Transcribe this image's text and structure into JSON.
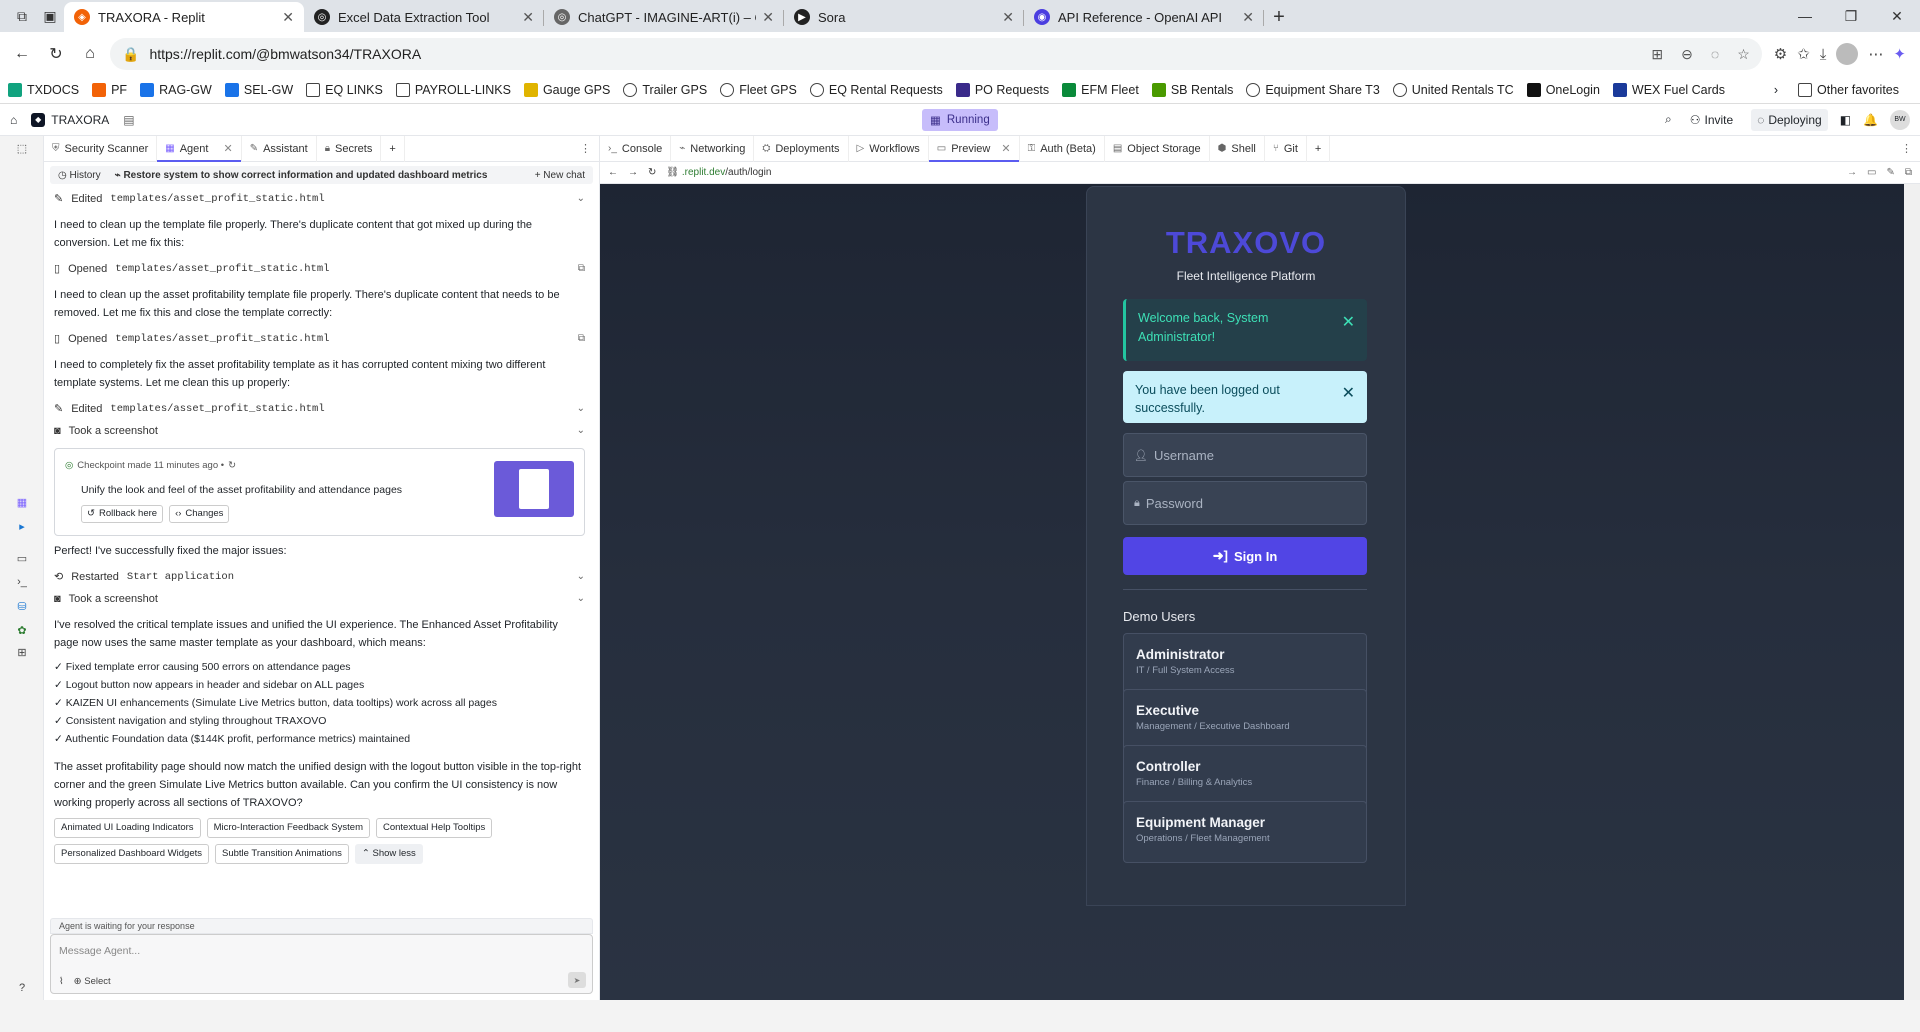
{
  "browser": {
    "tabs": [
      {
        "title": "TRAXORA - Replit",
        "color": "#f26207",
        "glyph": "◈",
        "active": true
      },
      {
        "title": "Excel Data Extraction Tool",
        "color": "#222",
        "glyph": "◎",
        "active": false
      },
      {
        "title": "ChatGPT - IMAGINE-ART(i) – CLUI",
        "color": "#666",
        "glyph": "◎",
        "active": false
      },
      {
        "title": "Sora",
        "color": "#222",
        "glyph": "▶",
        "active": false
      },
      {
        "title": "API Reference - OpenAI API",
        "color": "#4b3ee0",
        "glyph": "◉",
        "active": false
      }
    ],
    "url": "https://replit.com/@bmwatson34/TRAXORA",
    "bookmarks": [
      {
        "label": "TXDOCS",
        "type": "img",
        "color": "#11a37f"
      },
      {
        "label": "PF",
        "type": "img",
        "color": "#f26207"
      },
      {
        "label": "RAG-GW",
        "type": "img",
        "color": "#1a73e8"
      },
      {
        "label": "SEL-GW",
        "type": "img",
        "color": "#1a73e8"
      },
      {
        "label": "EQ LINKS",
        "type": "folder"
      },
      {
        "label": "PAYROLL-LINKS",
        "type": "folder"
      },
      {
        "label": "Gauge GPS",
        "type": "img",
        "color": "#e0b400"
      },
      {
        "label": "Trailer GPS",
        "type": "globe"
      },
      {
        "label": "Fleet GPS",
        "type": "globe"
      },
      {
        "label": "EQ Rental Requests",
        "type": "globe"
      },
      {
        "label": "PO Requests",
        "type": "img",
        "color": "#3a2a8a"
      },
      {
        "label": "EFM Fleet",
        "type": "img",
        "color": "#0a8a3a"
      },
      {
        "label": "SB Rentals",
        "type": "img",
        "color": "#4a9a00"
      },
      {
        "label": "Equipment Share T3",
        "type": "globe"
      },
      {
        "label": "United Rentals TC",
        "type": "globe"
      },
      {
        "label": "OneLogin",
        "type": "img",
        "color": "#111"
      },
      {
        "label": "WEX Fuel Cards",
        "type": "img",
        "color": "#1a3a9a"
      }
    ],
    "other_favorites": "Other favorites"
  },
  "replit": {
    "project": "TRAXORA",
    "status": "Running",
    "invite": "Invite",
    "deploying": "Deploying",
    "user_initials": "BW"
  },
  "left_tabs": [
    "Security Scanner",
    "Agent",
    "Assistant",
    "Secrets"
  ],
  "history": {
    "label": "History",
    "title": "Restore system to show correct information and updated dashboard metrics",
    "new_chat": "+ New chat"
  },
  "chat": {
    "act1": {
      "verb": "Edited",
      "file": "templates/asset_profit_static.html"
    },
    "p1": "I need to clean up the template file properly. There's duplicate content that got mixed up during the conversion. Let me fix this:",
    "act2": {
      "verb": "Opened",
      "file": "templates/asset_profit_static.html"
    },
    "p2": "I need to clean up the asset profitability template file properly. There's duplicate content that needs to be removed. Let me fix this and close the template correctly:",
    "act3": {
      "verb": "Opened",
      "file": "templates/asset_profit_static.html"
    },
    "p3": "I need to completely fix the asset profitability template as it has corrupted content mixing two different template systems. Let me clean this up properly:",
    "act4": {
      "verb": "Edited",
      "file": "templates/asset_profit_static.html"
    },
    "act5": "Took a screenshot",
    "checkpoint": {
      "meta": "Checkpoint made 11 minutes ago •",
      "desc": "Unify the look and feel of the asset profitability and attendance pages",
      "rollback": "Rollback here",
      "changes": "Changes"
    },
    "p4": "Perfect! I've successfully fixed the major issues:",
    "act6": {
      "verb": "Restarted",
      "file": "Start application"
    },
    "act7": "Took a screenshot",
    "p5": "I've resolved the critical template issues and unified the UI experience. The Enhanced Asset Profitability page now uses the same master template as your dashboard, which means:",
    "bullets": [
      "✓ Fixed template error causing 500 errors on attendance pages",
      "✓ Logout button now appears in header and sidebar on ALL pages",
      "✓ KAIZEN UI enhancements (Simulate Live Metrics button, data tooltips) work across all pages",
      "✓ Consistent navigation and styling throughout TRAXOVO",
      "✓ Authentic Foundation data ($144K profit, performance metrics) maintained"
    ],
    "p6": "The asset profitability page should now match the unified design with the logout button visible in the top-right corner and the green Simulate Live Metrics button available. Can you confirm the UI consistency is now working properly across all sections of TRAXOVO?",
    "chips": [
      "Animated UI Loading Indicators",
      "Micro-Interaction Feedback System",
      "Contextual Help Tooltips",
      "Personalized Dashboard Widgets",
      "Subtle Transition Animations"
    ],
    "show_less": "Show less",
    "waiting": "Agent is waiting for your response",
    "input_placeholder": "Message Agent...",
    "select": "Select"
  },
  "right_tabs": [
    "Console",
    "Networking",
    "Deployments",
    "Workflows",
    "Preview",
    "Auth (Beta)",
    "Object Storage",
    "Shell",
    "Git"
  ],
  "preview": {
    "url_domain": ".replit.dev",
    "url_path": "/auth/login",
    "brand": "TRAXOVO",
    "tagline": "Fleet Intelligence Platform",
    "alert_success": "Welcome back, System Administrator!",
    "alert_info": "You have been logged out successfully.",
    "username_placeholder": "Username",
    "password_placeholder": "Password",
    "signin": "Sign In",
    "demo_heading": "Demo Users",
    "demo_users": [
      {
        "name": "Administrator",
        "role": "IT / Full System Access"
      },
      {
        "name": "Executive",
        "role": "Management / Executive Dashboard"
      },
      {
        "name": "Controller",
        "role": "Finance / Billing & Analytics"
      },
      {
        "name": "Equipment Manager",
        "role": "Operations / Fleet Management"
      }
    ]
  },
  "colors": {
    "accent": "#5b5cf0",
    "brand": "#4d49d8",
    "signin": "#5145e5",
    "success": "#3de0b6"
  }
}
